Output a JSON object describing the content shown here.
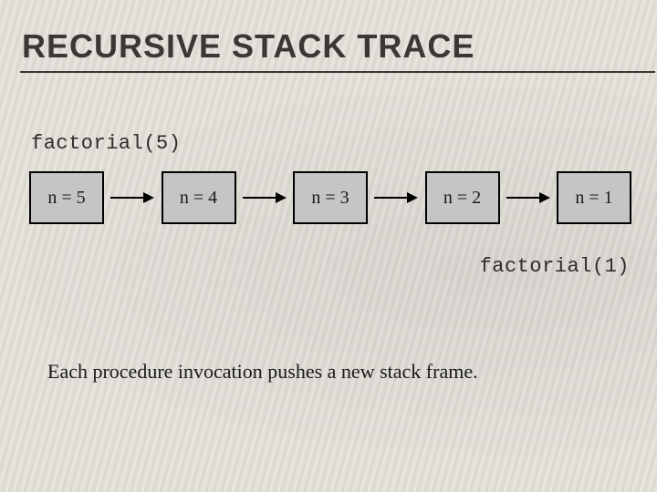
{
  "title": "RECURSIVE STACK TRACE",
  "top_call": "factorial(5)",
  "frames": [
    {
      "label": "n = 5"
    },
    {
      "label": "n = 4"
    },
    {
      "label": "n = 3"
    },
    {
      "label": "n = 2"
    },
    {
      "label": "n = 1"
    }
  ],
  "bottom_call": "factorial(1)",
  "caption": "Each procedure invocation pushes a new stack frame."
}
